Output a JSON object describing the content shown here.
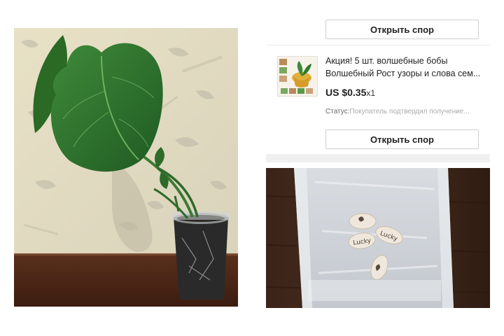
{
  "order": {
    "open_dispute_label": "Открыть спор",
    "product_title_line1": "Акция! 5 шт. волшебные бобы",
    "product_title_line2": "Волшебный Рост узоры и слова сем...",
    "price": "US $0.35",
    "quantity": "x1",
    "status_label": "Статус:",
    "status_value": "Покупатель подтвердил получение...",
    "open_dispute_label_2": "Открыть спор"
  },
  "seeds": {
    "seed_text_1": "Lucky",
    "seed_text_2": "Lucky"
  },
  "colors": {
    "button_border": "#cfcfcf",
    "status_text": "#aaaaaa",
    "divider": "#ececec"
  }
}
